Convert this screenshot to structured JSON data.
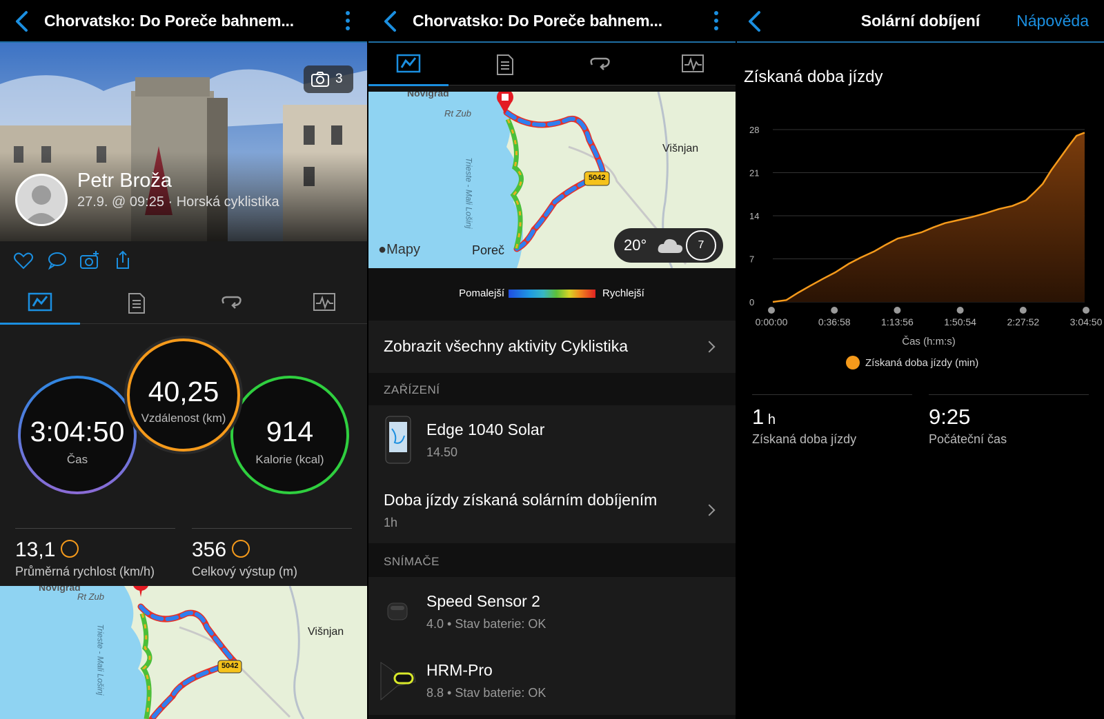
{
  "screen_activity": {
    "title": "Chorvatsko: Do Poreče bahnem...",
    "photo_count": "3",
    "user_name": "Petr Broža",
    "meta": "27.9. @ 09:25 · Horská cyklistika",
    "stats": {
      "time_value": "3:04:50",
      "time_label": "Čas",
      "distance_value": "40,25",
      "distance_label": "Vzdálenost (km)",
      "calories_value": "914",
      "calories_label": "Kalorie (kcal)"
    },
    "avg_speed_value": "13,1",
    "avg_speed_label": "Průměrná rychlost (km/h)",
    "ascent_value": "356",
    "ascent_label": "Celkový výstup (m)"
  },
  "map": {
    "labels": [
      "Novigrad",
      "Rt Zub",
      "Višnjan",
      "Poreč",
      "Trieste - Mali Lošinj"
    ],
    "road_badge": "5042",
    "attribution": "Mapy",
    "temperature": "20°",
    "wind": "7"
  },
  "screen_details": {
    "title": "Chorvatsko: Do Poreče bahnem...",
    "legend_slow": "Pomalejší",
    "legend_fast": "Rychlejší",
    "all_activities": "Zobrazit všechny aktivity Cyklistika",
    "section_device": "ZAŘÍZENÍ",
    "device_name": "Edge 1040 Solar",
    "device_version": "14.50",
    "solar_row_title": "Doba jízdy získaná solárním dobíjením",
    "solar_row_value": "1h",
    "section_sensors": "SNÍMAČE",
    "sensors": [
      {
        "name": "Speed Sensor 2",
        "info": "4.0 • Stav baterie: OK"
      },
      {
        "name": "HRM-Pro",
        "info": "8.8 • Stav baterie: OK"
      }
    ]
  },
  "screen_solar": {
    "title": "Solární dobíjení",
    "help": "Nápověda",
    "chart_title": "Získaná doba jízdy",
    "gained_value": "1",
    "gained_unit": "h",
    "gained_label": "Získaná doba jízdy",
    "start_value": "9:25",
    "start_label": "Počáteční čas"
  },
  "colors": {
    "accent": "#1b8fe0",
    "orange": "#f59a1b",
    "blue_ring": "#3b7fe0",
    "green_ring": "#2fcf3f"
  },
  "chart_data": {
    "type": "area",
    "title": "Získaná doba jízdy",
    "xlabel": "Čas (h:m:s)",
    "ylabel": "",
    "x_ticks": [
      "0:00:00",
      "0:36:58",
      "1:13:56",
      "1:50:54",
      "2:27:52",
      "3:04:50"
    ],
    "y_ticks": [
      0,
      7,
      14,
      21,
      28
    ],
    "ylim": [
      0,
      28
    ],
    "xlim": [
      0,
      184.83
    ],
    "legend": "Získaná doba jízdy (min)",
    "legend_position": "bottom",
    "grid": true,
    "x": [
      0,
      8,
      15,
      22,
      30,
      37,
      45,
      52,
      60,
      67,
      74,
      80,
      88,
      95,
      102,
      110,
      118,
      126,
      134,
      142,
      150,
      155,
      160,
      165,
      170,
      175,
      180,
      184.8
    ],
    "y": [
      0,
      0.3,
      1.5,
      2.6,
      3.8,
      4.8,
      6.2,
      7.2,
      8.2,
      9.3,
      10.3,
      10.7,
      11.3,
      12.1,
      12.8,
      13.3,
      13.8,
      14.4,
      15.1,
      15.6,
      16.5,
      17.8,
      19.2,
      21.4,
      23.3,
      25.2,
      27.0,
      27.5
    ]
  }
}
